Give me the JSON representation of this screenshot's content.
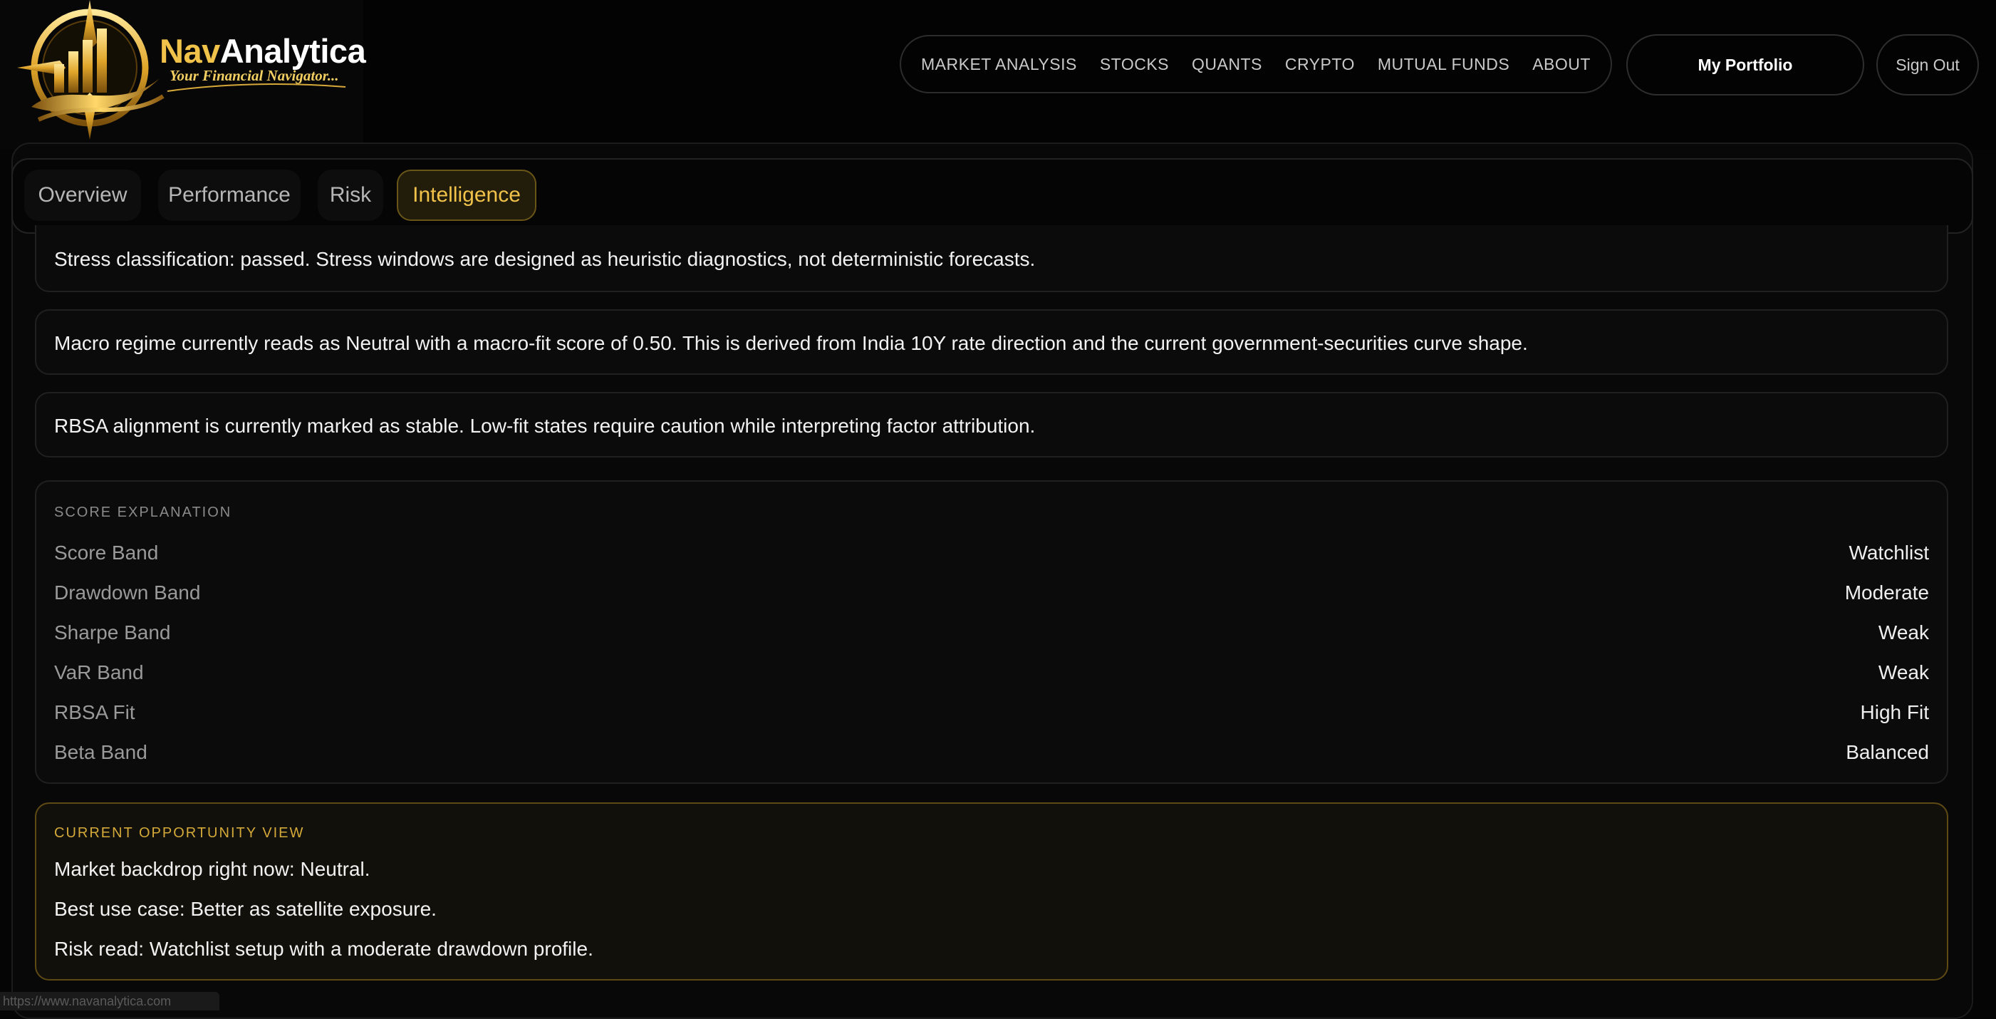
{
  "brand": {
    "name_prefix": "Nav",
    "name_suffix": "Analytica",
    "tagline": "Your Financial Navigator..."
  },
  "nav": {
    "links": [
      "MARKET ANALYSIS",
      "STOCKS",
      "QUANTS",
      "CRYPTO",
      "MUTUAL FUNDS",
      "ABOUT"
    ],
    "portfolio_label": "My Portfolio",
    "signout_label": "Sign Out"
  },
  "tabs": [
    {
      "label": "Overview",
      "active": false
    },
    {
      "label": "Performance",
      "active": false
    },
    {
      "label": "Risk",
      "active": false
    },
    {
      "label": "Intelligence",
      "active": true
    }
  ],
  "notes": [
    "Stress classification: passed. Stress windows are designed as heuristic diagnostics, not deterministic forecasts.",
    "Macro regime currently reads as Neutral with a macro-fit score of 0.50. This is derived from India 10Y rate direction and the current government-securities curve shape.",
    "RBSA alignment is currently marked as stable. Low-fit states require caution while interpreting factor attribution."
  ],
  "score_explanation": {
    "title": "SCORE EXPLANATION",
    "rows": [
      {
        "label": "Score Band",
        "value": "Watchlist"
      },
      {
        "label": "Drawdown Band",
        "value": "Moderate"
      },
      {
        "label": "Sharpe Band",
        "value": "Weak"
      },
      {
        "label": "VaR Band",
        "value": "Weak"
      },
      {
        "label": "RBSA Fit",
        "value": "High Fit"
      },
      {
        "label": "Beta Band",
        "value": "Balanced"
      }
    ]
  },
  "opportunity": {
    "title": "CURRENT OPPORTUNITY VIEW",
    "lines": [
      "Market backdrop right now: Neutral.",
      "Best use case: Better as satellite exposure.",
      "Risk read: Watchlist setup with a moderate drawdown profile."
    ]
  },
  "status_bar": {
    "url": "https://www.navanalytica.com"
  },
  "colors": {
    "accent": "#f0c24a",
    "background": "#050505"
  }
}
